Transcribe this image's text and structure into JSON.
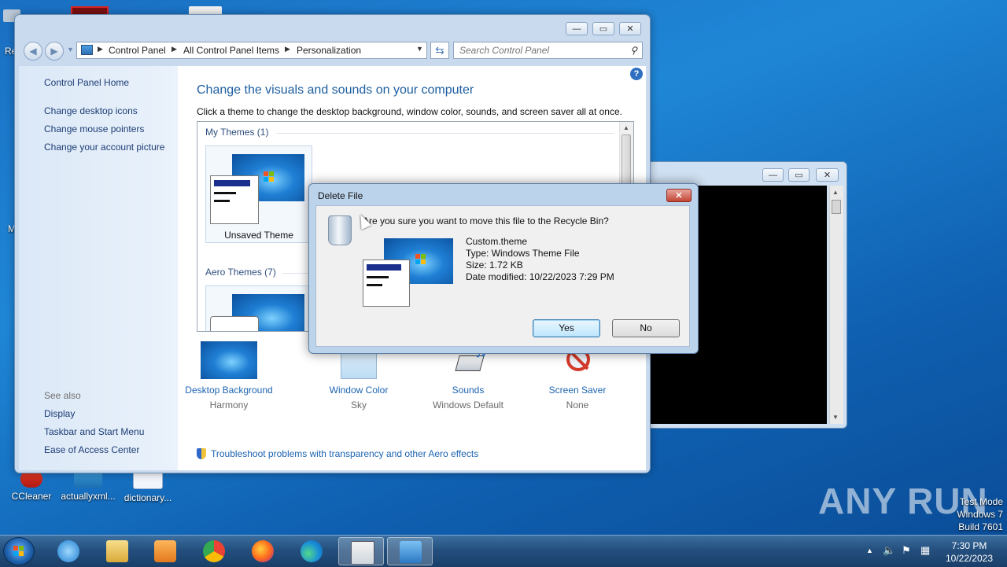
{
  "desktop": {
    "icons": [
      {
        "label": "CCleaner"
      },
      {
        "label": "actuallyxml..."
      },
      {
        "label": "dictionary..."
      }
    ],
    "left_edge_fragments": [
      "Re",
      "M"
    ],
    "watermark": "ANY RUN",
    "test_mode": [
      "Test Mode",
      "Windows 7",
      "Build 7601"
    ]
  },
  "cp_window": {
    "caption_buttons": [
      "—",
      "▭",
      "✕"
    ],
    "nav_back_icon": "back-arrow-icon",
    "breadcrumb": [
      "Control Panel",
      "All Control Panel Items",
      "Personalization"
    ],
    "search_placeholder": "Search Control Panel",
    "left_links": [
      "Control Panel Home",
      "Change desktop icons",
      "Change mouse pointers",
      "Change your account picture"
    ],
    "see_also_heading": "See also",
    "see_also_links": [
      "Display",
      "Taskbar and Start Menu",
      "Ease of Access Center"
    ],
    "heading": "Change the visuals and sounds on your computer",
    "subheading": "Click a theme to change the desktop background, window color, sounds, and screen saver all at once.",
    "help_label": "?",
    "groups": [
      {
        "title": "My Themes (1)",
        "themes": [
          {
            "name": "Unsaved Theme"
          }
        ]
      },
      {
        "title": "Aero Themes (7)",
        "themes": []
      }
    ],
    "bottom_items": [
      {
        "label": "Desktop Background",
        "value": "Harmony"
      },
      {
        "label": "Window Color",
        "value": "Sky"
      },
      {
        "label": "Sounds",
        "value": "Windows Default"
      },
      {
        "label": "Screen Saver",
        "value": "None"
      }
    ],
    "troubleshoot_link": "Troubleshoot problems with transparency and other Aero effects"
  },
  "dialog": {
    "title": "Delete File",
    "question": "Are you sure you want to move this file to the Recycle Bin?",
    "file_name": "Custom.theme",
    "file_type": "Type: Windows Theme File",
    "file_size": "Size: 1.72 KB",
    "file_modified": "Date modified: 10/22/2023 7:29 PM",
    "yes_label": "Yes",
    "no_label": "No",
    "close_label": "✕"
  },
  "taskbar": {
    "time": "7:30 PM",
    "date": "10/22/2023",
    "tray_icons": [
      "show-hidden-icons",
      "volume-icon",
      "action-center-flag-icon",
      "network-icon"
    ]
  },
  "colors": {
    "link_blue": "#1d64b1",
    "heading_blue": "#1e5fa0",
    "dialog_frame": "#bcd3ec"
  }
}
